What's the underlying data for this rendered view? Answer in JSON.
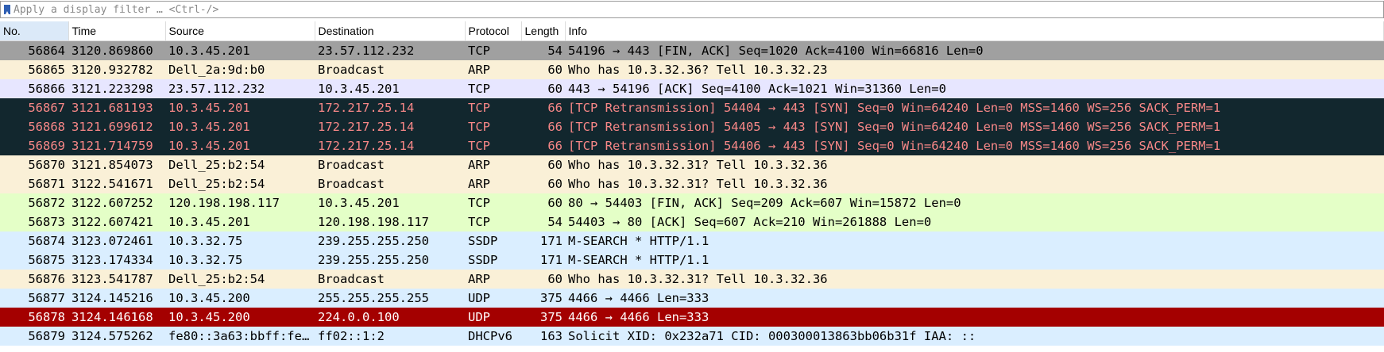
{
  "filter": {
    "placeholder": "Apply a display filter … <Ctrl-/>",
    "icon": "bookmark-icon"
  },
  "columns": [
    {
      "key": "no",
      "label": "No."
    },
    {
      "key": "time",
      "label": "Time"
    },
    {
      "key": "source",
      "label": "Source"
    },
    {
      "key": "destination",
      "label": "Destination"
    },
    {
      "key": "protocol",
      "label": "Protocol"
    },
    {
      "key": "length",
      "label": "Length"
    },
    {
      "key": "info",
      "label": "Info"
    }
  ],
  "colors": {
    "tcp_fin": {
      "bg": "#a0a0a0",
      "fg": "#000000"
    },
    "arp": {
      "bg": "#faf0d7",
      "fg": "#000000"
    },
    "tcp": {
      "bg": "#e7e6ff",
      "fg": "#000000"
    },
    "bad_tcp": {
      "bg": "#12272e",
      "fg": "#f78787"
    },
    "http_tcp": {
      "bg": "#e4ffc7",
      "fg": "#000000"
    },
    "udp": {
      "bg": "#daeeff",
      "fg": "#000000"
    },
    "udp_red": {
      "bg": "#a40000",
      "fg": "#fffcfc"
    }
  },
  "rows": [
    {
      "no": "56864",
      "time": "3120.869860",
      "source": "10.3.45.201",
      "destination": "23.57.112.232",
      "protocol": "TCP",
      "length": "54",
      "info": "54196 → 443 [FIN, ACK] Seq=1020 Ack=4100 Win=66816 Len=0",
      "style": "tcp_fin"
    },
    {
      "no": "56865",
      "time": "3120.932782",
      "source": "Dell_2a:9d:b0",
      "destination": "Broadcast",
      "protocol": "ARP",
      "length": "60",
      "info": "Who has 10.3.32.36? Tell 10.3.32.23",
      "style": "arp"
    },
    {
      "no": "56866",
      "time": "3121.223298",
      "source": "23.57.112.232",
      "destination": "10.3.45.201",
      "protocol": "TCP",
      "length": "60",
      "info": "443 → 54196 [ACK] Seq=4100 Ack=1021 Win=31360 Len=0",
      "style": "tcp"
    },
    {
      "no": "56867",
      "time": "3121.681193",
      "source": "10.3.45.201",
      "destination": "172.217.25.14",
      "protocol": "TCP",
      "length": "66",
      "info": "[TCP Retransmission] 54404 → 443 [SYN] Seq=0 Win=64240 Len=0 MSS=1460 WS=256 SACK_PERM=1",
      "style": "bad_tcp"
    },
    {
      "no": "56868",
      "time": "3121.699612",
      "source": "10.3.45.201",
      "destination": "172.217.25.14",
      "protocol": "TCP",
      "length": "66",
      "info": "[TCP Retransmission] 54405 → 443 [SYN] Seq=0 Win=64240 Len=0 MSS=1460 WS=256 SACK_PERM=1",
      "style": "bad_tcp"
    },
    {
      "no": "56869",
      "time": "3121.714759",
      "source": "10.3.45.201",
      "destination": "172.217.25.14",
      "protocol": "TCP",
      "length": "66",
      "info": "[TCP Retransmission] 54406 → 443 [SYN] Seq=0 Win=64240 Len=0 MSS=1460 WS=256 SACK_PERM=1",
      "style": "bad_tcp"
    },
    {
      "no": "56870",
      "time": "3121.854073",
      "source": "Dell_25:b2:54",
      "destination": "Broadcast",
      "protocol": "ARP",
      "length": "60",
      "info": "Who has 10.3.32.31? Tell 10.3.32.36",
      "style": "arp"
    },
    {
      "no": "56871",
      "time": "3122.541671",
      "source": "Dell_25:b2:54",
      "destination": "Broadcast",
      "protocol": "ARP",
      "length": "60",
      "info": "Who has 10.3.32.31? Tell 10.3.32.36",
      "style": "arp"
    },
    {
      "no": "56872",
      "time": "3122.607252",
      "source": "120.198.198.117",
      "destination": "10.3.45.201",
      "protocol": "TCP",
      "length": "60",
      "info": "80 → 54403 [FIN, ACK] Seq=209 Ack=607 Win=15872 Len=0",
      "style": "http_tcp"
    },
    {
      "no": "56873",
      "time": "3122.607421",
      "source": "10.3.45.201",
      "destination": "120.198.198.117",
      "protocol": "TCP",
      "length": "54",
      "info": "54403 → 80 [ACK] Seq=607 Ack=210 Win=261888 Len=0",
      "style": "http_tcp"
    },
    {
      "no": "56874",
      "time": "3123.072461",
      "source": "10.3.32.75",
      "destination": "239.255.255.250",
      "protocol": "SSDP",
      "length": "171",
      "info": "M-SEARCH * HTTP/1.1",
      "style": "udp"
    },
    {
      "no": "56875",
      "time": "3123.174334",
      "source": "10.3.32.75",
      "destination": "239.255.255.250",
      "protocol": "SSDP",
      "length": "171",
      "info": "M-SEARCH * HTTP/1.1",
      "style": "udp"
    },
    {
      "no": "56876",
      "time": "3123.541787",
      "source": "Dell_25:b2:54",
      "destination": "Broadcast",
      "protocol": "ARP",
      "length": "60",
      "info": "Who has 10.3.32.31? Tell 10.3.32.36",
      "style": "arp"
    },
    {
      "no": "56877",
      "time": "3124.145216",
      "source": "10.3.45.200",
      "destination": "255.255.255.255",
      "protocol": "UDP",
      "length": "375",
      "info": "4466 → 4466 Len=333",
      "style": "udp"
    },
    {
      "no": "56878",
      "time": "3124.146168",
      "source": "10.3.45.200",
      "destination": "224.0.0.100",
      "protocol": "UDP",
      "length": "375",
      "info": "4466 → 4466 Len=333",
      "style": "udp_red"
    },
    {
      "no": "56879",
      "time": "3124.575262",
      "source": "fe80::3a63:bbff:fe0…",
      "destination": "ff02::1:2",
      "protocol": "DHCPv6",
      "length": "163",
      "info": "Solicit XID: 0x232a71 CID: 000300013863bb06b31f IAA: ::",
      "style": "udp"
    }
  ]
}
